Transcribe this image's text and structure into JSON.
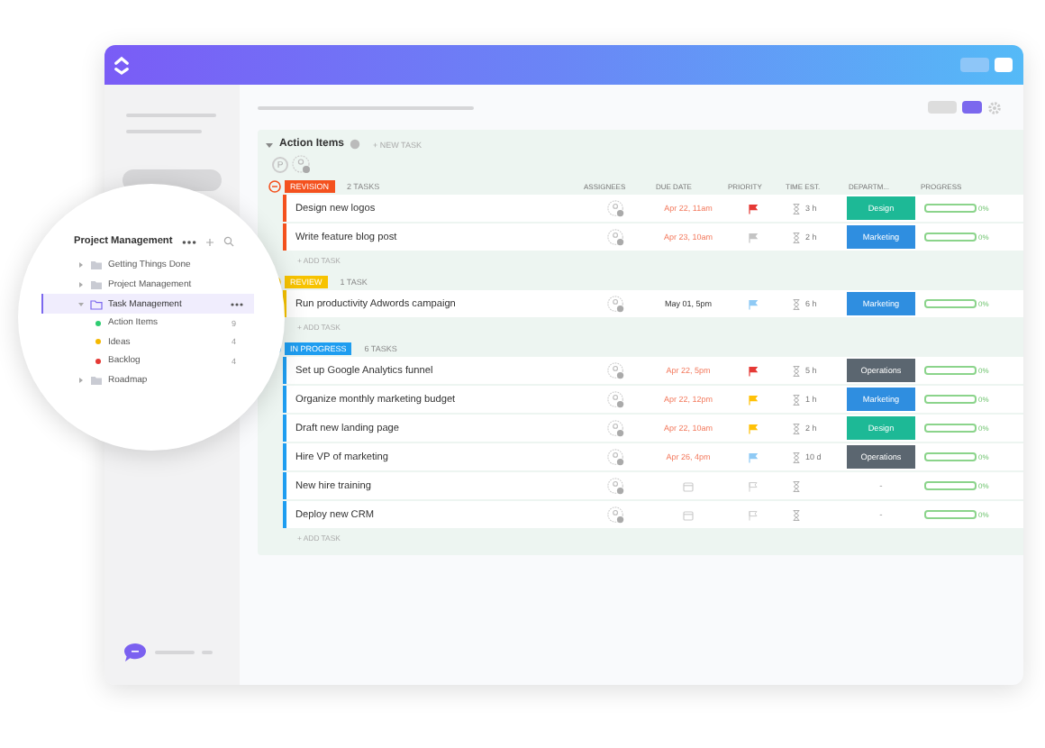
{
  "sidebar_popup": {
    "title": "Project Management",
    "items": [
      {
        "label": "Getting Things Done",
        "selected": false,
        "expanded": false
      },
      {
        "label": "Project Management",
        "selected": false,
        "expanded": false
      },
      {
        "label": "Task Management",
        "selected": true,
        "expanded": true,
        "children": [
          {
            "label": "Action Items",
            "color": "#2ecc71",
            "count": "9"
          },
          {
            "label": "Ideas",
            "color": "#f5b800",
            "count": "4"
          },
          {
            "label": "Backlog",
            "color": "#e53935",
            "count": "4"
          }
        ]
      },
      {
        "label": "Roadmap",
        "selected": false,
        "expanded": false
      }
    ]
  },
  "list": {
    "title": "Action Items",
    "new_task": "+ NEW TASK",
    "avatar": "P",
    "columns": [
      "ASSIGNEES",
      "DUE DATE",
      "PRIORITY",
      "TIME EST.",
      "DEPARTM...",
      "PROGRESS"
    ],
    "groups": [
      {
        "status": "REVISION",
        "color": "#f4511e",
        "count": "2 TASKS",
        "add_task": "+ ADD TASK",
        "tasks": [
          {
            "name": "Design new logos",
            "due": "Apr 22, 11am",
            "overdue": true,
            "flag": {
              "color": "#e53935"
            },
            "time": "3 h",
            "department": {
              "label": "Design",
              "color": "#1db996"
            },
            "progress": "0%",
            "level": 0
          },
          {
            "name": "Write feature blog post",
            "due": "Apr 23, 10am",
            "overdue": true,
            "flag": {
              "color": "#c4c4c4"
            },
            "time": "2 h",
            "department": {
              "label": "Marketing",
              "color": "#2f8ee0"
            },
            "progress": "0%",
            "level": 0
          }
        ]
      },
      {
        "status": "REVIEW",
        "color": "#f7c300",
        "count": "1 TASK",
        "add_task": "+ ADD TASK",
        "tasks": [
          {
            "name": "Run productivity Adwords campaign",
            "due": "May 01, 5pm",
            "overdue": false,
            "flag": {
              "color": "#8fcaf5"
            },
            "time": "6 h",
            "department": {
              "label": "Marketing",
              "color": "#2f8ee0"
            },
            "progress": "0%",
            "level": 0
          }
        ]
      },
      {
        "status": "IN PROGRESS",
        "color": "#1e9df0",
        "count": "6 TASKS",
        "add_task": "+ ADD TASK",
        "tasks": [
          {
            "name": "Set up Google Analytics funnel",
            "due": "Apr 22, 5pm",
            "overdue": true,
            "flag": {
              "color": "#e53935"
            },
            "time": "5 h",
            "department": {
              "label": "Operations",
              "color": "#5b6670"
            },
            "progress": "0%",
            "level": 0
          },
          {
            "name": "Organize monthly marketing budget",
            "due": "Apr 22, 12pm",
            "overdue": true,
            "flag": {
              "color": "#ffc107"
            },
            "time": "1 h",
            "department": {
              "label": "Marketing",
              "color": "#2f8ee0"
            },
            "progress": "0%",
            "level": 0
          },
          {
            "name": "Draft new landing page",
            "due": "Apr 22, 10am",
            "overdue": true,
            "flag": {
              "color": "#ffc107"
            },
            "time": "2 h",
            "department": {
              "label": "Design",
              "color": "#1db996"
            },
            "progress": "0%",
            "level": 0
          },
          {
            "name": "Hire VP of marketing",
            "due": "Apr 26, 4pm",
            "overdue": true,
            "flag": {
              "color": "#8fcaf5"
            },
            "time": "10 d",
            "department": {
              "label": "Operations",
              "color": "#5b6670"
            },
            "progress": "0%",
            "level": 0
          },
          {
            "name": "New hire training",
            "empty_department": "-",
            "progress": "0%",
            "level": 0
          },
          {
            "name": "Deploy new CRM",
            "empty_department": "-",
            "progress": "0%",
            "level": 0
          }
        ]
      }
    ]
  }
}
